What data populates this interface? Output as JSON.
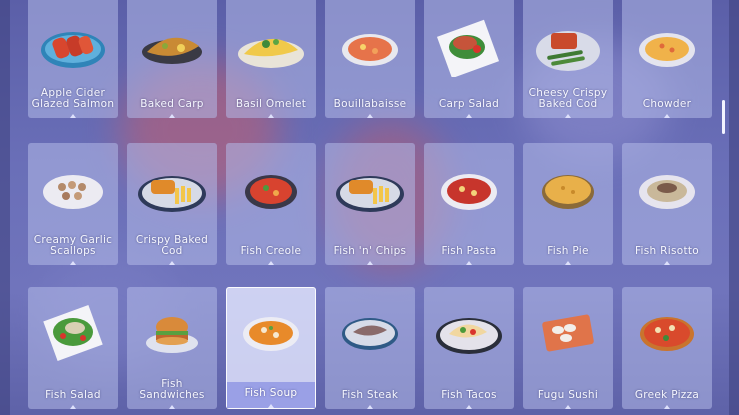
{
  "recipes": [
    {
      "label": "Apple Cider Glazed Salmon",
      "icon": "glazed-salmon-icon"
    },
    {
      "label": "Baked Carp",
      "icon": "baked-carp-icon"
    },
    {
      "label": "Basil Omelet",
      "icon": "omelet-icon"
    },
    {
      "label": "Bouillabaisse",
      "icon": "bouillabaisse-icon"
    },
    {
      "label": "Carp Salad",
      "icon": "carp-salad-icon"
    },
    {
      "label": "Cheesy Crispy Baked Cod",
      "icon": "baked-cod-icon"
    },
    {
      "label": "Chowder",
      "icon": "chowder-icon"
    },
    {
      "label": "Creamy Garlic Scallops",
      "icon": "scallops-icon"
    },
    {
      "label": "Crispy Baked Cod",
      "icon": "crispy-cod-icon"
    },
    {
      "label": "Fish Creole",
      "icon": "fish-creole-icon"
    },
    {
      "label": "Fish 'n' Chips",
      "icon": "fish-chips-icon"
    },
    {
      "label": "Fish Pasta",
      "icon": "fish-pasta-icon"
    },
    {
      "label": "Fish Pie",
      "icon": "fish-pie-icon"
    },
    {
      "label": "Fish Risotto",
      "icon": "fish-risotto-icon"
    },
    {
      "label": "Fish Salad",
      "icon": "fish-salad-icon"
    },
    {
      "label": "Fish Sandwiches",
      "icon": "sandwich-icon"
    },
    {
      "label": "Fish Soup",
      "icon": "fish-soup-icon",
      "selected": true
    },
    {
      "label": "Fish Steak",
      "icon": "fish-steak-icon"
    },
    {
      "label": "Fish Tacos",
      "icon": "fish-tacos-icon"
    },
    {
      "label": "Fugu Sushi",
      "icon": "sushi-icon"
    },
    {
      "label": "Greek Pizza",
      "icon": "pizza-icon"
    }
  ]
}
